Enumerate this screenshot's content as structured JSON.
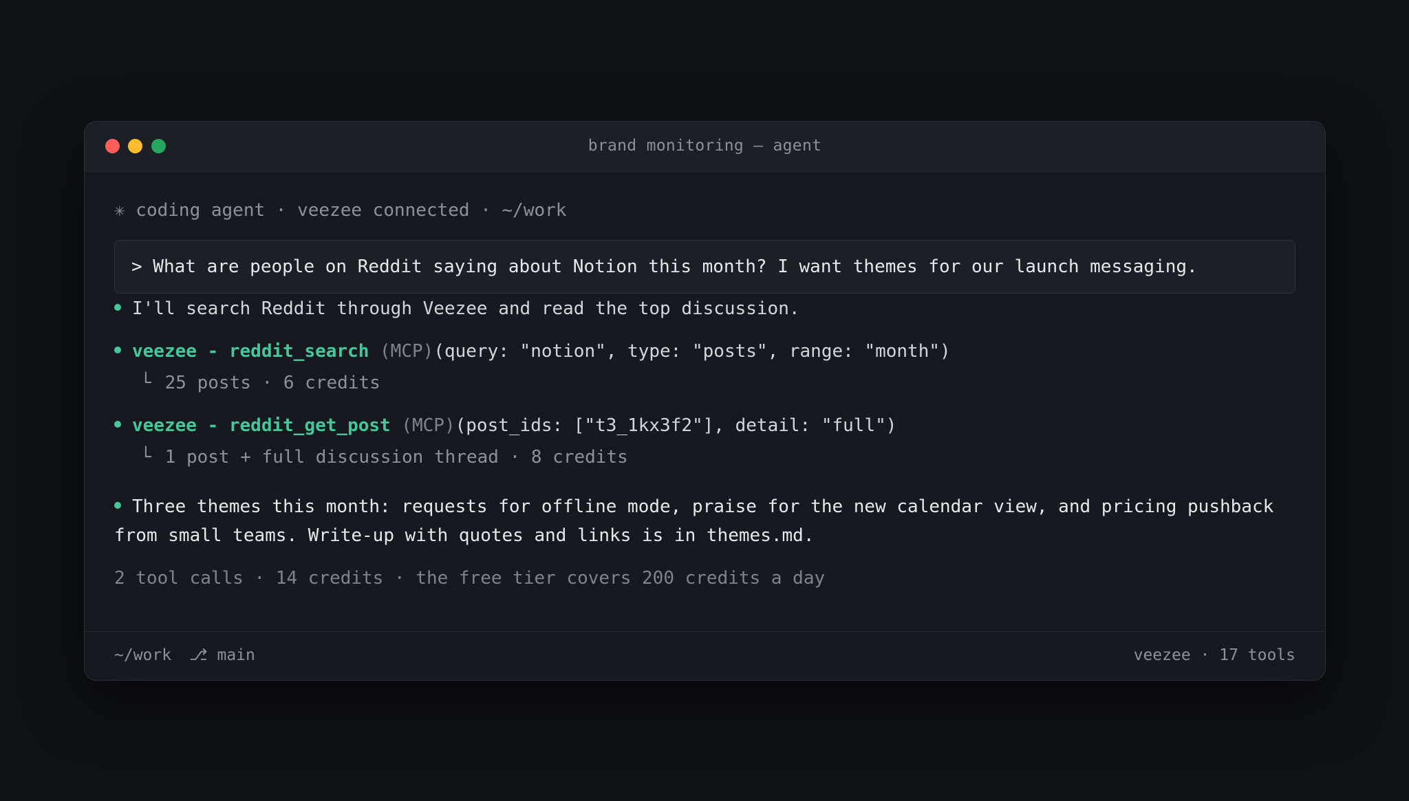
{
  "window": {
    "title": "brand monitoring — agent",
    "controls": {
      "close_color": "#ff5f57",
      "minimize_color": "#febc2e",
      "maximize_color": "#28a55f"
    }
  },
  "session_header": "✳ coding agent · veezee connected · ~/work",
  "prompt": "> What are people on Reddit saying about Notion this month? I want themes for our launch messaging.",
  "transcript": {
    "intro": "I'll search Reddit through Veezee and read the top discussion.",
    "tool_calls": [
      {
        "name": "veezee - reddit_search",
        "tag": "(MCP)",
        "args": "(query: \"notion\", type: \"posts\", range: \"month\")",
        "branch": "└",
        "result": "25 posts · 6 credits"
      },
      {
        "name": "veezee - reddit_get_post",
        "tag": "(MCP)",
        "args": "(post_ids: [\"t3_1kx3f2\"], detail: \"full\")",
        "branch": "└",
        "result": "1 post + full discussion thread · 8 credits"
      }
    ],
    "summary": "Three themes this month: requests for offline mode, praise for the new calendar view, and pricing pushback from small teams. Write-up with quotes and links is in themes.md.",
    "footer_note": "2 tool calls · 14 credits · the free tier covers 200 credits a day"
  },
  "statusbar": {
    "cwd": "~/work",
    "branch_icon": "⎇",
    "branch": "main",
    "right": "veezee · 17 tools"
  },
  "colors": {
    "accent": "#46c79a",
    "background": "#0e1116",
    "panel": "#161a20"
  }
}
